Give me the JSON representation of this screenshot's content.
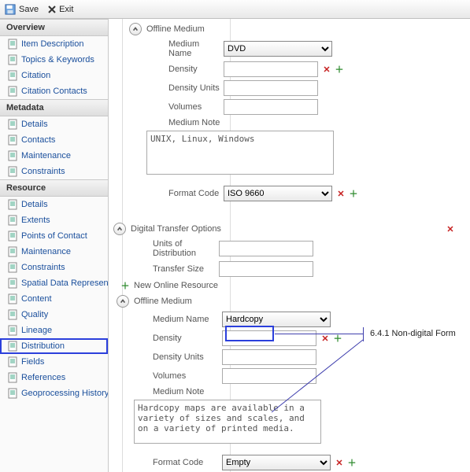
{
  "toolbar": {
    "save": "Save",
    "exit": "Exit"
  },
  "sidebar": {
    "sections": [
      {
        "title": "Overview",
        "items": [
          "Item Description",
          "Topics & Keywords",
          "Citation",
          "Citation Contacts"
        ]
      },
      {
        "title": "Metadata",
        "items": [
          "Details",
          "Contacts",
          "Maintenance",
          "Constraints"
        ]
      },
      {
        "title": "Resource",
        "items": [
          "Details",
          "Extents",
          "Points of Contact",
          "Maintenance",
          "Constraints",
          "Spatial Data Representation",
          "Content",
          "Quality",
          "Lineage",
          "Distribution",
          "Fields",
          "References",
          "Geoprocessing History"
        ]
      }
    ],
    "selected": "Distribution"
  },
  "form": {
    "offline1": {
      "section": "Offline Medium",
      "mediumNameLabel": "Medium Name",
      "mediumNameValue": "DVD",
      "densityLabel": "Density",
      "densityValue": "",
      "densityUnitsLabel": "Density Units",
      "densityUnitsValue": "",
      "volumesLabel": "Volumes",
      "volumesValue": "",
      "mediumNoteLabel": "Medium Note",
      "mediumNoteValue": "UNIX, Linux, Windows",
      "formatCodeLabel": "Format Code",
      "formatCodeValue": "ISO 9660"
    },
    "dto": {
      "section": "Digital Transfer Options",
      "unitsLabel": "Units of Distribution",
      "unitsValue": "",
      "transferSizeLabel": "Transfer Size",
      "transferSizeValue": "",
      "newOnline": "New Online Resource"
    },
    "offline2": {
      "section": "Offline Medium",
      "mediumNameLabel": "Medium Name",
      "mediumNameValue": "Hardcopy",
      "densityLabel": "Density",
      "densityValue": "",
      "densityUnitsLabel": "Density Units",
      "densityUnitsValue": "",
      "volumesLabel": "Volumes",
      "volumesValue": "",
      "mediumNoteLabel": "Medium Note",
      "mediumNoteValue": "Hardcopy maps are available in a variety of sizes and scales, and on a variety of printed media.",
      "formatCodeLabel": "Format Code",
      "formatCodeValue": "Empty"
    }
  },
  "annotation": "6.4.1 Non-digital Form"
}
